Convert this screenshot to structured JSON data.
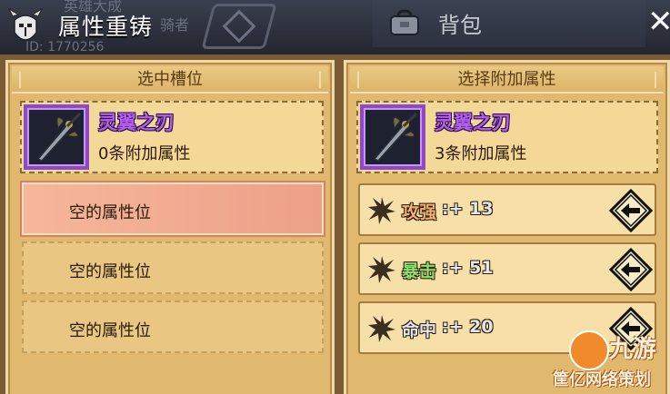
{
  "header": {
    "title": "属性重铸",
    "background_ghost_text": [
      "英雄大成",
      "骑者",
      "ID: 1770256"
    ],
    "tab_backpack_label": "背包",
    "close_symbol": "✕"
  },
  "left_panel": {
    "header": "选中槽位",
    "item": {
      "name": "灵翼之刃",
      "sub": "0条附加属性",
      "icon": "sword-icon"
    },
    "slots": [
      {
        "label": "空的属性位",
        "selected": true
      },
      {
        "label": "空的属性位",
        "selected": false
      },
      {
        "label": "空的属性位",
        "selected": false
      }
    ]
  },
  "right_panel": {
    "header": "选择附加属性",
    "item": {
      "name": "灵翼之刃",
      "sub": "3条附加属性",
      "icon": "sword-icon"
    },
    "attributes": [
      {
        "name": "攻强",
        "value": ":+ 13",
        "color": "#f1b27a"
      },
      {
        "name": "暴击",
        "value": ":+ 51",
        "color": "#8de070"
      },
      {
        "name": "命中",
        "value": ":+ 20",
        "color": "#e3e7ef"
      }
    ]
  },
  "watermark": {
    "title": "九游",
    "subtitle": "筐亿网络策划"
  },
  "colors": {
    "rare_purple": "#b35ff0",
    "panel_bg": "#e0b86e",
    "selected_slot": "#f6b79c"
  }
}
